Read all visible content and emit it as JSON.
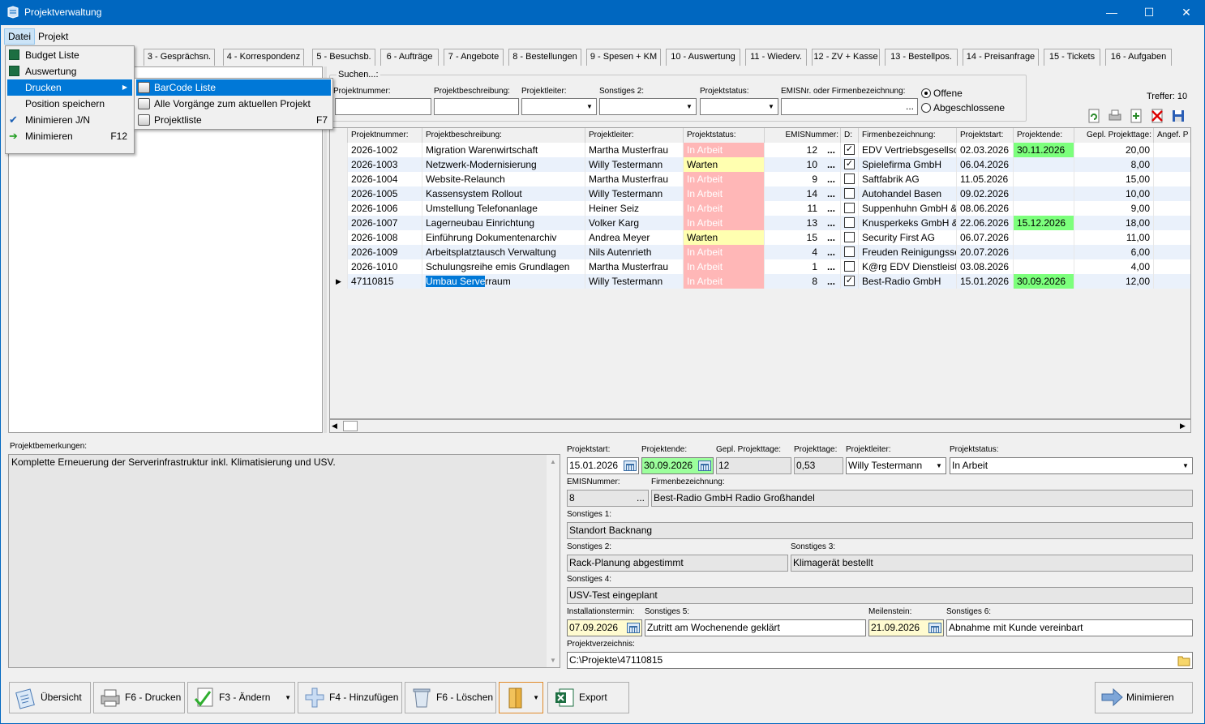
{
  "window": {
    "title": "Projektverwaltung"
  },
  "menu": {
    "datei": "Datei",
    "projekt": "Projekt"
  },
  "datei_menu": [
    {
      "label": "Budget Liste",
      "shortcut": "",
      "icon": "excel-icon"
    },
    {
      "label": "Auswertung",
      "shortcut": "",
      "icon": "excel-icon"
    },
    {
      "label": "Drucken",
      "shortcut": "",
      "icon": "submenu-arrow-icon"
    },
    {
      "label": "Position speichern",
      "shortcut": "",
      "icon": ""
    },
    {
      "label": "Minimieren J/N",
      "shortcut": "",
      "icon": "checkmark-icon"
    },
    {
      "label": "Minimieren",
      "shortcut": "F12",
      "icon": "green-arrow-icon"
    }
  ],
  "drucken_menu": [
    {
      "label": "BarCode Liste",
      "shortcut": ""
    },
    {
      "label": "Alle Vorgänge zum aktuellen Projekt",
      "shortcut": ""
    },
    {
      "label": "Projektliste",
      "shortcut": "F7"
    }
  ],
  "tabs": [
    "3 - Gesprächsn.",
    "4 - Korrespondenz",
    "5 - Besuchsb.",
    "6 - Aufträge",
    "7 - Angebote",
    "8 - Bestellungen",
    "9 - Spesen + KM",
    "10 - Auswertung",
    "11 - Wiederv.",
    "12 - ZV + Kasse",
    "13 - Bestellpos.",
    "14 - Preisanfrage",
    "15 - Tickets",
    "16 - Aufgaben"
  ],
  "search": {
    "legend": "Suchen...:",
    "labels": {
      "projektnummer": "Projektnummer:",
      "beschreibung": "Projektbeschreibung:",
      "leiter": "Projektleiter:",
      "sonstiges2": "Sonstiges 2:",
      "status": "Projektstatus:",
      "emis": "EMISNr. oder Firmenbezeichnung:"
    },
    "radio_offene": "Offene",
    "radio_abgeschlossene": "Abgeschlossene",
    "treffer": "Treffer: 10",
    "emis_button": "..."
  },
  "grid": {
    "headers": [
      "Projektnummer:",
      "Projektbeschreibung:",
      "Projektleiter:",
      "Projektstatus:",
      "EMISNummer:",
      "D:",
      "Firmenbezeichnung:",
      "Projektstart:",
      "Projektende:",
      "Gepl. Projekttage:",
      "Angef. P"
    ],
    "rows": [
      {
        "nr": "2026-1002",
        "desc": "Migration Warenwirtschaft",
        "leiter": "Martha Musterfrau",
        "status": "In Arbeit",
        "emis": "12",
        "d": true,
        "firma": "EDV Vertriebsgesellsc",
        "start": "02.03.2026",
        "ende": "30.11.2026",
        "tage": "20,00"
      },
      {
        "nr": "2026-1003",
        "desc": "Netzwerk-Modernisierung",
        "leiter": "Willy Testermann",
        "status": "Warten",
        "emis": "10",
        "d": true,
        "firma": "Spielefirma GmbH",
        "start": "06.04.2026",
        "ende": "",
        "tage": "8,00"
      },
      {
        "nr": "2026-1004",
        "desc": "Website-Relaunch",
        "leiter": "Martha Musterfrau",
        "status": "In Arbeit",
        "emis": "9",
        "d": false,
        "firma": "Saftfabrik AG",
        "start": "11.05.2026",
        "ende": "",
        "tage": "15,00"
      },
      {
        "nr": "2026-1005",
        "desc": "Kassensystem Rollout",
        "leiter": "Willy Testermann",
        "status": "In Arbeit",
        "emis": "14",
        "d": false,
        "firma": "Autohandel Basen",
        "start": "09.02.2026",
        "ende": "",
        "tage": "10,00"
      },
      {
        "nr": "2026-1006",
        "desc": "Umstellung Telefonanlage",
        "leiter": "Heiner Seiz",
        "status": "In Arbeit",
        "emis": "11",
        "d": false,
        "firma": "Suppenhuhn GmbH &",
        "start": "08.06.2026",
        "ende": "",
        "tage": "9,00"
      },
      {
        "nr": "2026-1007",
        "desc": "Lagerneubau Einrichtung",
        "leiter": "Volker Karg",
        "status": "In Arbeit",
        "emis": "13",
        "d": false,
        "firma": "Knusperkeks GmbH &",
        "start": "22.06.2026",
        "ende": "15.12.2026",
        "tage": "18,00"
      },
      {
        "nr": "2026-1008",
        "desc": "Einführung Dokumentenarchiv",
        "leiter": "Andrea Meyer",
        "status": "Warten",
        "emis": "15",
        "d": false,
        "firma": "Security First AG",
        "start": "06.07.2026",
        "ende": "",
        "tage": "11,00"
      },
      {
        "nr": "2026-1009",
        "desc": "Arbeitsplatztausch Verwaltung",
        "leiter": "Nils Autenrieth",
        "status": "In Arbeit",
        "emis": "4",
        "d": false,
        "firma": "Freuden Reinigungsse",
        "start": "20.07.2026",
        "ende": "",
        "tage": "6,00"
      },
      {
        "nr": "2026-1010",
        "desc": "Schulungsreihe emis Grundlagen",
        "leiter": "Martha Musterfrau",
        "status": "In Arbeit",
        "emis": "1",
        "d": false,
        "firma": "K@rg EDV Dienstleist",
        "start": "03.08.2026",
        "ende": "",
        "tage": "4,00"
      },
      {
        "nr": "47110815",
        "desc": "Umbau Serverraum",
        "leiter": "Willy Testermann",
        "status": "In Arbeit",
        "emis": "8",
        "d": true,
        "firma": "Best-Radio GmbH",
        "start": "15.01.2026",
        "ende": "30.09.2026",
        "tage": "12,00"
      }
    ],
    "ellipsis": "...",
    "selected_highlight": "Umbau Serve",
    "selected_rest": "rraum"
  },
  "details": {
    "bemerkungen_label": "Projektbemerkungen:",
    "bemerkungen": "Komplette Erneuerung der Serverinfrastruktur inkl. Klimatisierung und USV.",
    "labels": {
      "start": "Projektstart:",
      "ende": "Projektende:",
      "gepl": "Gepl. Projekttage:",
      "tage": "Projekttage:",
      "leiter": "Projektleiter:",
      "status": "Projektstatus:",
      "emis": "EMISNummer:",
      "firma": "Firmenbezeichnung:",
      "s1": "Sonstiges 1:",
      "s2": "Sonstiges 2:",
      "s3": "Sonstiges 3:",
      "s4": "Sonstiges 4:",
      "install": "Installationstermin:",
      "s5": "Sonstiges 5:",
      "meilen": "Meilenstein:",
      "s6": "Sonstiges 6:",
      "verz": "Projektverzeichnis:"
    },
    "values": {
      "start": "15.01.2026",
      "ende": "30.09.2026",
      "gepl": "12",
      "tage": "0,53",
      "leiter": "Willy Testermann",
      "status": "In Arbeit",
      "emis": "8",
      "emis_btn": "...",
      "firma": "Best-Radio GmbH Radio Großhandel",
      "s1": "Standort Backnang",
      "s2": "Rack-Planung abgestimmt",
      "s3": "Klimagerät bestellt",
      "s4": "USV-Test eingeplant",
      "install": "07.09.2026",
      "s5": "Zutritt am Wochenende geklärt",
      "meilen": "21.09.2026",
      "s6": "Abnahme mit Kunde vereinbart",
      "verz": "C:\\Projekte\\47110815"
    }
  },
  "buttons": {
    "uebersicht": "Übersicht",
    "drucken": "F6 - Drucken",
    "aendern": "F3 - Ändern",
    "hinzufuegen": "F4 - Hinzufügen",
    "loeschen": "F6 - Löschen",
    "export": "Export",
    "minimieren": "Minimieren"
  }
}
